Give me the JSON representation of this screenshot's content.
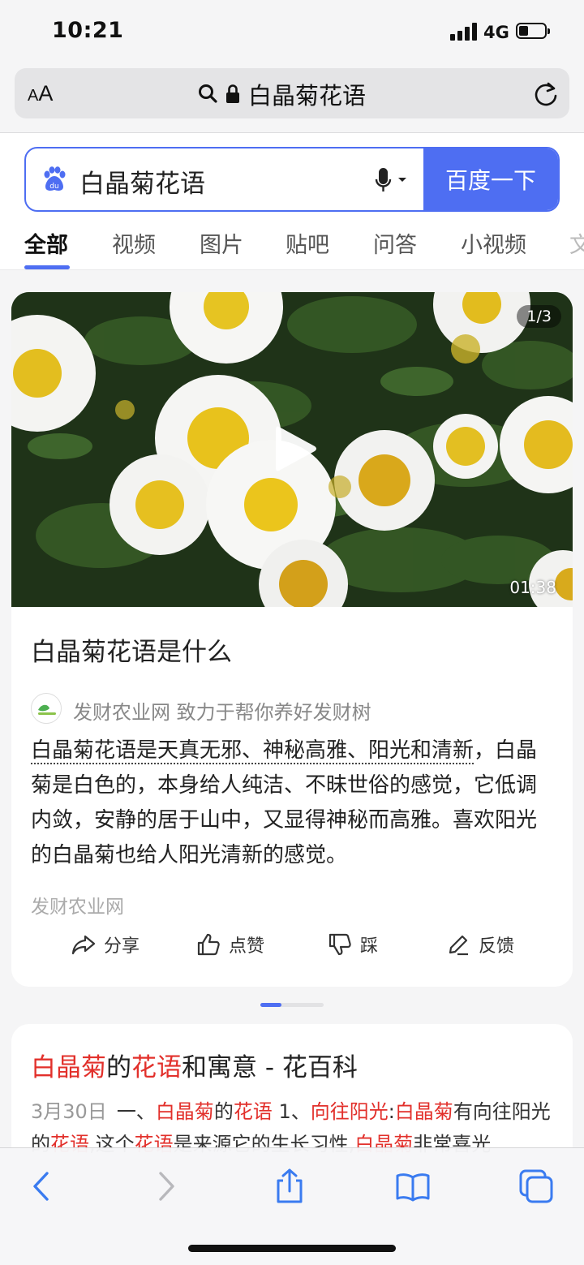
{
  "status_bar": {
    "time": "10:21",
    "network": "4G"
  },
  "address_bar": {
    "text_size_small": "A",
    "text_size_big": "A",
    "url": "白晶菊花语",
    "icons": [
      "search-icon",
      "lock-icon",
      "reload-icon"
    ]
  },
  "search": {
    "query": "白晶菊花语",
    "button_label": "百度一下",
    "icons": [
      "baidu-paw-icon",
      "microphone-icon"
    ]
  },
  "tabs": [
    {
      "label": "全部",
      "active": true
    },
    {
      "label": "视频"
    },
    {
      "label": "图片"
    },
    {
      "label": "贴吧"
    },
    {
      "label": "问答"
    },
    {
      "label": "小视频"
    },
    {
      "label": "文"
    }
  ],
  "video_card": {
    "page_badge": "1/3",
    "duration": "01:38",
    "title": "白晶菊花语是什么",
    "source_name": "发财农业网",
    "source_slogan": "致力于帮你养好发财树",
    "body_highlight": "白晶菊花语是天真无邪、神秘高雅、阳光和清新",
    "body_rest": "，白晶菊是白色的，本身给人纯洁、不昧世俗的感觉，它低调内敛，安静的居于山中，又显得神秘而高雅。喜欢阳光的白晶菊也给人阳光清新的感觉。",
    "site": "发财农业网",
    "actions": {
      "share": "分享",
      "like": "点赞",
      "dislike": "踩",
      "feedback": "反馈"
    }
  },
  "result2": {
    "title_parts": [
      "白晶菊",
      "的",
      "花语",
      "和寓意 - 花百科"
    ],
    "date": "3月30日",
    "snippet_parts": [
      "一、",
      "白晶菊",
      "的",
      "花语",
      " 1、",
      "向往阳光",
      ":",
      "白晶菊",
      "有向往阳光的",
      "花语",
      ",这个",
      "花语",
      "是来源它的生长习性,",
      "白晶菊",
      "非常喜光"
    ]
  },
  "toolbar_icons": [
    "back-icon",
    "forward-icon",
    "share-icon",
    "bookmarks-icon",
    "tabs-icon"
  ],
  "colors": {
    "accent": "#4e6ef2",
    "highlight_red": "#e2302b",
    "background": "#f5f5f6"
  }
}
